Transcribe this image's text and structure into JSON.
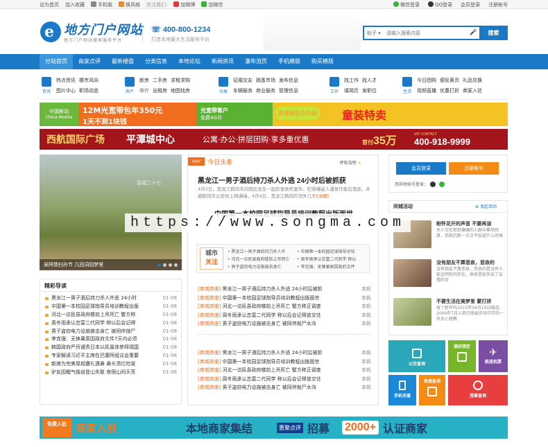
{
  "topbar": {
    "left": [
      "设为首页",
      "加入收藏",
      "手机版",
      "换风格",
      "关注我们:",
      "加微博",
      "加微信"
    ],
    "right": [
      "微信登录",
      "QQ登录",
      "会员登录",
      "注册帐号"
    ]
  },
  "header": {
    "logo_mark": "e",
    "logo_title": "地方门户网站",
    "logo_sub": "地方门户网站搜索服务平台",
    "phone": "400-800-1234",
    "phone_sub": "打造本地最大生活服务平台",
    "search_category": "帖子",
    "search_placeholder": "请输入搜索内容",
    "search_button": "搜索"
  },
  "nav": [
    "分站首页",
    "商家点评",
    "最新楼盘",
    "分类信息",
    "本地论坛",
    "新闻资讯",
    "瀑布流页",
    "手机模版",
    "购买模版"
  ],
  "subnav": [
    {
      "icon": "资讯",
      "links": [
        "热点资讯",
        "楼市风向",
        "",
        "图片中心",
        "职场动态",
        ""
      ]
    },
    {
      "icon": "房产",
      "links": [
        "新房",
        "二手房",
        "求租求购",
        "中介",
        "出租房",
        "地图找房"
      ]
    },
    {
      "icon": "分类",
      "links": [
        "征婚交友",
        "跳蚤市场",
        "发布信息",
        "车辆服务",
        "商业服务",
        "管理信息"
      ]
    },
    {
      "icon": "工作",
      "links": [
        "找工作",
        "找人才",
        "",
        "填简历",
        "发职位",
        ""
      ]
    },
    {
      "icon": "生活",
      "links": [
        "今日团购",
        "便民黄页",
        "礼品兑换",
        "视频直播",
        "优惠打折",
        "商家入驻"
      ]
    }
  ],
  "banner1": {
    "mobile": "中国移动",
    "mobile_en": "China Mobile",
    "promo1": "12M光宽带包年350元",
    "promo2": "1天不到1块钱",
    "promo3": "光宽带客户",
    "promo4": "免费4G月",
    "shop": "凯德新民众乐园",
    "kids": "童装特卖"
  },
  "banner2": {
    "a": "西航国际广场",
    "b": "平潭城中心",
    "c": "公寓·办公·拼层团购·享多重优惠",
    "d": "35万",
    "prefix": "首付",
    "e": "400-918-9999",
    "vip": "VIP CONTACT"
  },
  "slider": {
    "caption": "吴阿情扫孙节 几回词回梦里",
    "overlay": "县城二十七"
  },
  "featured": {
    "title": "精彩导读",
    "items": [
      {
        "t": "黑龙江一男子酒后持刀杀人外逃 24小时",
        "d": "01-08"
      },
      {
        "t": "中国第一本校园足球指导员培训教程出版",
        "d": "01-08"
      },
      {
        "t": "河北一访民县政府楼前上吊死亡 警方称",
        "d": "01-08"
      },
      {
        "t": "周冬雨承认恋富二代同学 称以后会记得",
        "d": "01-08"
      },
      {
        "t": "男子盗窃电力设施被击身亡 被同伴抛尸",
        "d": "01-08"
      },
      {
        "t": "李克强：无锋果原因政府文件7天内必须",
        "d": "01-08"
      },
      {
        "t": "韩国政府严厉谴责日本以民属体参拜靖国",
        "d": "01-08"
      },
      {
        "t": "专家解读习近平主席在巴塞阿组议会重要",
        "d": "01-08"
      },
      {
        "t": "新娘为完美晃相遭礼遇鼻 鼻头溃烂险毁",
        "d": "01-08"
      },
      {
        "t": "驴友因醒气独自登山失联 夜宿山间天亮",
        "d": "01-08"
      }
    ]
  },
  "center": {
    "hot_badge": "Hot",
    "hot_title": "今日头条",
    "weather": "呼和浩特",
    "headline1": "黑龙江一男子酒后持刀杀人外逃 24小时后被抓获",
    "summary1": "4月3日，黑龙江鹤岗市向阳区发生一起伤害致死案件，犯罪嫌疑人潘某作案后潜逃，并被鹤岗市公安局上网通缉。4月4日，黑龙江鹤岗的消失几天",
    "summary1_more": "[详细]",
    "headline2": "中国第一本校园足球指导员培训教程出版面世",
    "city_a": "城市",
    "city_b": "关注",
    "city_links": [
      "黑龙江一男子酒后持刀杀人外",
      "中国第一本校园足球指导员培",
      "河北一访民县政府楼前上吊死亡",
      "周冬雨承认恋富二代同学 称以",
      "男子盗窃电力设施被击身亡",
      "李克强：无锋果原因政府文件"
    ],
    "news1": [
      {
        "tag": "[商城茶座]",
        "t": "黑龙江一男子酒后持刀杀人外逃 24小时后被抓",
        "a": "本帆"
      },
      {
        "tag": "[商城茶座]",
        "t": "中国第一本校园足球指导员培训教程出版面世",
        "a": "本帆"
      },
      {
        "tag": "[商城茶座]",
        "t": "河北一访民县政府楼前上吊死亡 警方称正调查",
        "a": "本帆"
      },
      {
        "tag": "[商城茶座]",
        "t": "周冬雨承认恋富二代同学 称以后会记得曾交往",
        "a": "本帆"
      },
      {
        "tag": "[商城茶座]",
        "t": "男子盗窃电力设施被击身亡 被同伴抛尸水沟",
        "a": "本帆"
      }
    ],
    "news2": [
      {
        "tag": "[商城茶座]",
        "t": "黑龙江一男子酒后持刀杀人外逃 24小时后被抓",
        "a": "本帆"
      },
      {
        "tag": "[商城茶座]",
        "t": "中国第一本校园足球指导员培训教程出版面世",
        "a": "本帆"
      },
      {
        "tag": "[商城茶座]",
        "t": "河北一访民县政府楼前上吊死亡 警方称正调查",
        "a": "本帆"
      },
      {
        "tag": "[商城茶座]",
        "t": "周冬雨承认恋富二代同学 称以后会记得曾交往",
        "a": "本帆"
      },
      {
        "tag": "[商城茶座]",
        "t": "男子盗窃电力设施被击身亡 被同伴抛尸水沟",
        "a": "本帆"
      }
    ]
  },
  "login": {
    "login_button": "会员登录",
    "register_button": "注册帐号",
    "other": "用其他帐号登录："
  },
  "community": {
    "title": "同城活动",
    "post": "发起活动",
    "items": [
      {
        "title": "盼怀花开的声音 不要再误",
        "desc": "多少次在熙熙攘攘的人群中蓦然回首，而能的那一点点不知道什么时候"
      },
      {
        "title": "没有朋友不算悲哀，悲哀的",
        "desc": "没有朋友不算悲哀，悲哀的是没有人能证明你的存在，原来是给失去了友情的日"
      },
      {
        "title": "不要生活在美梦里 蒙打拼",
        "desc": "留了新年吗2015年04月16日报道，2004年7月入职河南省实验中学的一名女心理教"
      }
    ]
  },
  "tiles": [
    {
      "label": "公交查询",
      "color": "#2aa7b8"
    },
    {
      "label": "酒店预定",
      "color": "#77b62c"
    },
    {
      "label": "航班机票",
      "color": "#7a4fa3"
    },
    {
      "label": "手机充值",
      "color": "#1b88d8"
    },
    {
      "label": "快递查询",
      "color": "#f38b14"
    },
    {
      "label": "违章查询",
      "color": "#e83e40"
    }
  ],
  "bottom": {
    "a": "免费入驻",
    "b": "商家入驻",
    "c": "本地商家集结",
    "d": "惠聚点评",
    "e": "招募",
    "f": "2000+",
    "g": "认证商家"
  },
  "watermark": "https://www.songma.com"
}
